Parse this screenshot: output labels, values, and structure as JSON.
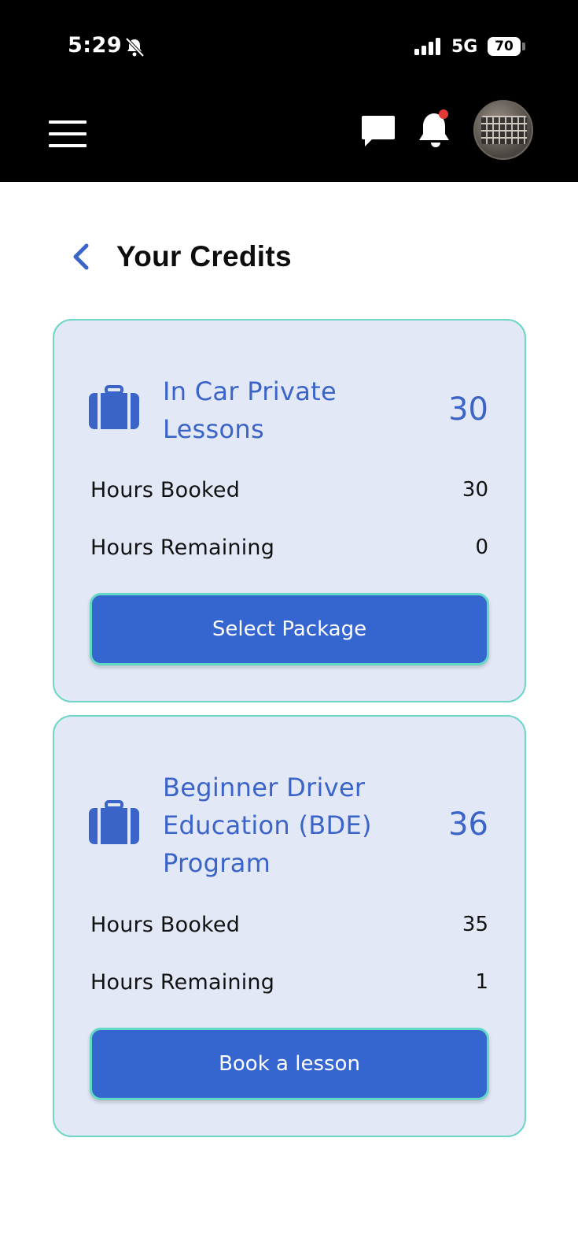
{
  "status_bar": {
    "time": "5:29",
    "network": "5G",
    "battery": "70"
  },
  "page": {
    "title": "Your Credits"
  },
  "credits": [
    {
      "name_line1": "In Car Private",
      "name_line2": "Lessons",
      "total": "30",
      "hours_booked_label": "Hours Booked",
      "hours_booked": "30",
      "hours_remaining_label": "Hours Remaining",
      "hours_remaining": "0",
      "action_label": "Select Package"
    },
    {
      "name_line1": "Beginner Driver",
      "name_line2": "Education (BDE)",
      "name_line3": "Program",
      "total": "36",
      "hours_booked_label": "Hours Booked",
      "hours_booked": "35",
      "hours_remaining_label": "Hours Remaining",
      "hours_remaining": "1",
      "action_label": "Book a lesson"
    }
  ],
  "icons": {
    "menu": "hamburger-menu-icon",
    "messages": "chat-bubble-icon",
    "notifications": "bell-icon",
    "back": "chevron-left-icon",
    "package": "briefcase-icon"
  },
  "colors": {
    "accent_blue": "#3a64c8",
    "button_blue": "#3565cf",
    "card_bg": "#e2e8f6",
    "card_border": "#6fd6c6",
    "notification_dot": "#e53935"
  }
}
